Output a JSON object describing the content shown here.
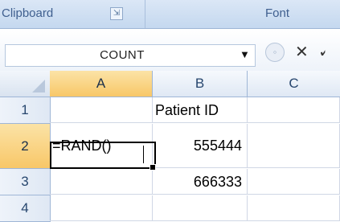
{
  "ribbon": {
    "clipboard_label": "Clipboard",
    "clipboard_launcher": "⇲",
    "font_label": "Font"
  },
  "formula_bar": {
    "name_box_value": "COUNT",
    "name_box_arrow": "▼",
    "fx_icon": "fx-icon",
    "cancel_symbol": "✕",
    "enter_symbol": "✓"
  },
  "columns": [
    "A",
    "B",
    "C"
  ],
  "rows": [
    {
      "number": "1",
      "cells": [
        "",
        "Patient ID",
        ""
      ]
    },
    {
      "number": "2",
      "cells": [
        "=RAND()",
        "555444",
        ""
      ]
    },
    {
      "number": "3",
      "cells": [
        "",
        "666333",
        ""
      ]
    },
    {
      "number": "4",
      "cells": [
        "",
        "",
        ""
      ]
    }
  ],
  "active_cell": "A2",
  "colors": {
    "header_active": "#f8c768",
    "ribbon": "#c4d8ef",
    "gridline": "#d0d7e5"
  }
}
